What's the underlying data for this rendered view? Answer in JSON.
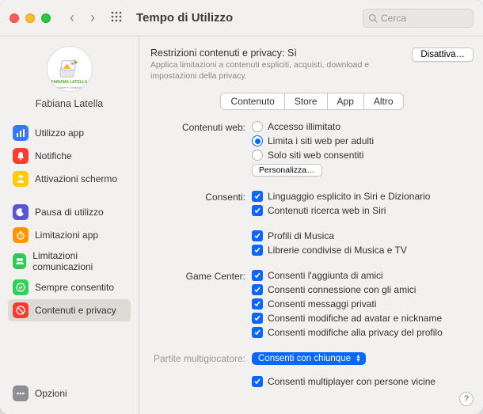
{
  "window": {
    "title": "Tempo di Utilizzo"
  },
  "search": {
    "placeholder": "Cerca"
  },
  "profile": {
    "name": "Fabiana Latella",
    "avatar_banner": "FABIANA LATELLA",
    "avatar_sub": "Supporter ✦ Ghost writer"
  },
  "sidebar": {
    "items": [
      {
        "label": "Utilizzo app"
      },
      {
        "label": "Notifiche"
      },
      {
        "label": "Attivazioni schermo"
      },
      {
        "label": "Pausa di utilizzo"
      },
      {
        "label": "Limitazioni app"
      },
      {
        "label": "Limitazioni comunicazioni"
      },
      {
        "label": "Sempre consentito"
      },
      {
        "label": "Contenuti e privacy"
      }
    ],
    "options": "Opzioni"
  },
  "main": {
    "header": {
      "title_prefix": "Restrizioni contenuti e privacy: ",
      "title_value": "Sì",
      "subtitle": "Applica limitazioni a contenuti espliciti, acquisti, download e impostazioni della privacy.",
      "disable_btn": "Disattiva…"
    },
    "tabs": [
      "Contenuto",
      "Store",
      "App",
      "Altro"
    ],
    "labels": {
      "web": "Contenuti web:",
      "allow": "Consenti:",
      "game_center": "Game Center:",
      "multiplayer": "Partite multigiocatore:"
    },
    "web_radios": [
      "Accesso illimitato",
      "Limita i siti web per adulti",
      "Solo siti web consentiti"
    ],
    "customize_btn": "Personalizza…",
    "allow_group1": [
      "Linguaggio esplicito in Siri e Dizionario",
      "Contenuti ricerca web in Siri"
    ],
    "allow_group2": [
      "Profili di Musica",
      "Librerie condivise di Musica e TV"
    ],
    "gc_checks": [
      "Consenti l'aggiunta di amici",
      "Consenti connessione con gli amici",
      "Consenti messaggi privati",
      "Consenti modifiche ad avatar e nickname",
      "Consenti modifiche alla privacy del profilo"
    ],
    "multiplayer_select": "Consenti con chiunque",
    "nearby_check": "Consenti multiplayer con persone vicine"
  }
}
